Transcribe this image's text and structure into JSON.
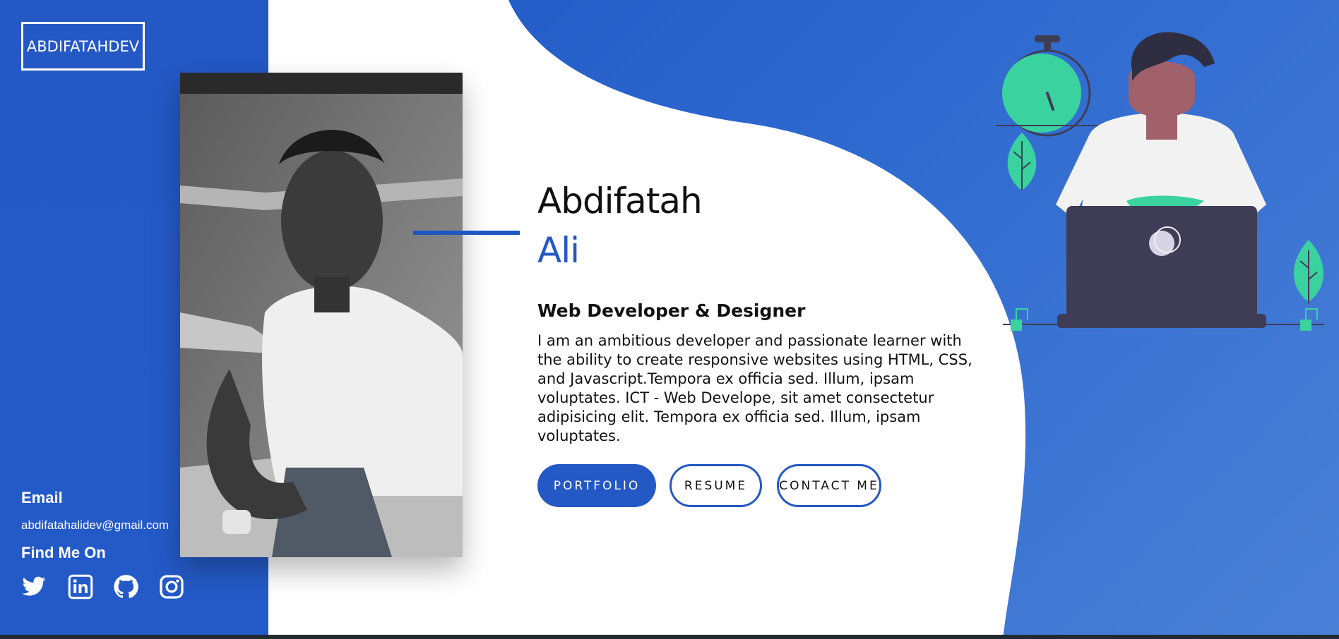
{
  "brand": {
    "label": "ABDIFATAHDEV"
  },
  "hero": {
    "first_name": "Abdifatah",
    "last_name": "Ali",
    "role": "Web Developer & Designer",
    "bio": "I am an ambitious developer and passionate learner with the ability to create responsive websites using HTML, CSS, and Javascript.Tempora ex officia sed. Illum, ipsam voluptates. ICT - Web Develope, sit amet consectetur adipisicing elit. Tempora ex officia sed. Illum, ipsam voluptates."
  },
  "buttons": {
    "portfolio": "PORTFOLIO",
    "resume": "RESUME",
    "contact": "CONTACT ME"
  },
  "sidebar": {
    "email_heading": "Email",
    "email_value": "abdifatahalidev@gmail.com",
    "social_heading": "Find Me On",
    "social_icons": [
      "twitter-icon",
      "linkedin-icon",
      "github-icon",
      "instagram-icon"
    ]
  },
  "colors": {
    "primary": "#2458c4",
    "text": "#111111",
    "accent_green": "#3ad29f",
    "laptop": "#3f3d56"
  }
}
